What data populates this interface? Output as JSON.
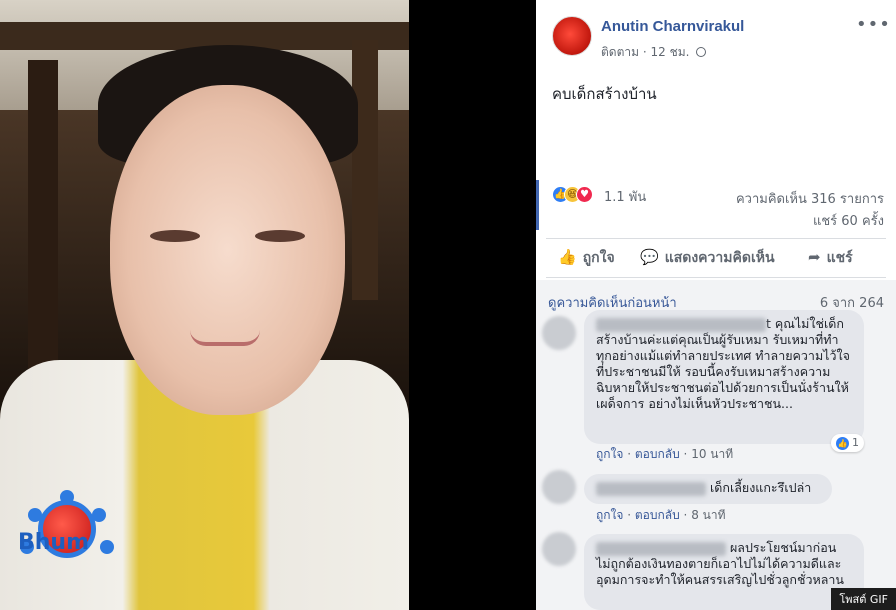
{
  "post": {
    "author": "Anutin Charnvirakul",
    "meta_follow": "ติดตาม",
    "meta_time": "12 ชม.",
    "more_icon": "more-dots-icon",
    "text": "คบเด็กสร้างบ้าน"
  },
  "stats": {
    "reaction_icons": [
      "like-icon",
      "haha-icon",
      "love-icon"
    ],
    "reaction_count": "1.1 พัน",
    "comments": "ความคิดเห็น 316 รายการ",
    "shares": "แชร์ 60 ครั้ง"
  },
  "actions": {
    "like": "ถูกใจ",
    "comment": "แสดงความคิดเห็น",
    "share": "แชร์"
  },
  "comments_section": {
    "view_previous": "ดูความคิดเห็นก่อนหน้า",
    "count_of": "6 จาก 264",
    "comments": [
      {
        "name_suffix": "t",
        "text_first": "คุณไม่ใช่เด็ก",
        "text_rest": "สร้างบ้านค่ะแต่คุณเป็นผู้รับเหมา รับเหมาที่ทำทุกอย่างแม้แต่ทำลายประเทศ ทำลายความไว้ใจที่ประชาชนมีให้ รอบนี้คงรับเหมาสร้างความฉิบหายให้ประชาชนต่อไปด้วยการเป็นนั่งร้านให้เผด็จการ อย่างไม่เห็นหัวประชาชน...",
        "reactions": "1",
        "like": "ถูกใจ",
        "reply": "ตอบกลับ",
        "time": "10 นาที"
      },
      {
        "text": "เด็กเลี้ยงแกะรึเปล่า",
        "like": "ถูกใจ",
        "reply": "ตอบกลับ",
        "time": "8 นาที"
      },
      {
        "text_first": "ผลประโยชน์มาก่อน",
        "text_rest": "ไม่ถูกต้องเงินทองตายก็เอาไปไม่ได้ความดีและอุดมการจะทำให้คนสรรเสริญไปชั่วลูกชั่วหลาน"
      }
    ],
    "gif_label": "โพสต์ GIF"
  }
}
